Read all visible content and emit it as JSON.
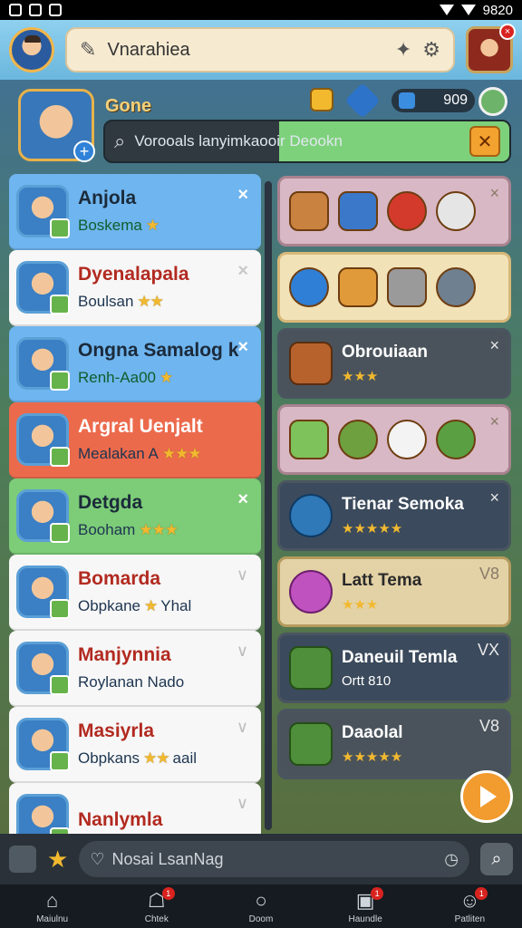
{
  "status_bar": {
    "time": "9820"
  },
  "top_bar": {
    "search_value": "Vnarahiea"
  },
  "hero": {
    "label": "Gone",
    "score": "909",
    "search_value": "Vorooals lanyimkaooir Deookn"
  },
  "friends": [
    {
      "name": "Anjola",
      "sub": "Boskema",
      "stars": "★",
      "style": "blue",
      "mark": "close"
    },
    {
      "name": "Dyenalapala",
      "sub": "Boulsan",
      "stars": "★★",
      "style": "white",
      "mark": "close"
    },
    {
      "name": "Ongna Samalog k",
      "sub": "Renh-Aa00",
      "stars": "★",
      "style": "blue",
      "mark": "close"
    },
    {
      "name": "Argral Uenjalt",
      "sub": "Mealakan A",
      "stars": "★★★",
      "style": "red",
      "mark": ""
    },
    {
      "name": "Detgda",
      "sub": "Booham",
      "stars": "★★★",
      "style": "green",
      "mark": "close"
    },
    {
      "name": "Bomarda",
      "sub": "Obpkane",
      "stars": "★",
      "extra": "Yhal",
      "style": "white",
      "mark": "check"
    },
    {
      "name": "Manjynnia",
      "sub": "Roylanan Nado",
      "stars": "",
      "style": "white",
      "mark": "check"
    },
    {
      "name": "Masiyrla",
      "sub": "Obpkans",
      "stars": "★★",
      "extra": "aail",
      "style": "white",
      "mark": "check"
    },
    {
      "name": "Nanlymla",
      "sub": "",
      "stars": "",
      "style": "white",
      "mark": "check"
    }
  ],
  "cards": [
    {
      "style": "pink",
      "kind": "icons"
    },
    {
      "style": "beige",
      "kind": "icons"
    },
    {
      "style": "dark",
      "title": "Obrouiaan",
      "sub": "★★★",
      "mark": "×"
    },
    {
      "style": "pink",
      "kind": "icons"
    },
    {
      "style": "slate",
      "title": "Tienar Semoka",
      "sub": "★★★★★",
      "mark": "×"
    },
    {
      "style": "sand",
      "title": "Latt Tema",
      "sub": "★★★",
      "mark": "V8"
    },
    {
      "style": "slate",
      "title": "Daneuil Temla",
      "sub": "Ortt 810",
      "mark": "VX"
    },
    {
      "style": "dark",
      "title": "Daaolal",
      "sub": "★★★★★",
      "mark": "V8"
    }
  ],
  "bottom_search": {
    "placeholder": "Nosai LsanNag"
  },
  "tabs": [
    {
      "label": "Maiulnu",
      "icon": "home-icon",
      "badge": ""
    },
    {
      "label": "Chtek",
      "icon": "chat-icon",
      "badge": "1"
    },
    {
      "label": "Doom",
      "icon": "search-icon",
      "badge": ""
    },
    {
      "label": "Haundle",
      "icon": "gift-icon",
      "badge": "1"
    },
    {
      "label": "Patliten",
      "icon": "profile-icon",
      "badge": "1"
    }
  ]
}
